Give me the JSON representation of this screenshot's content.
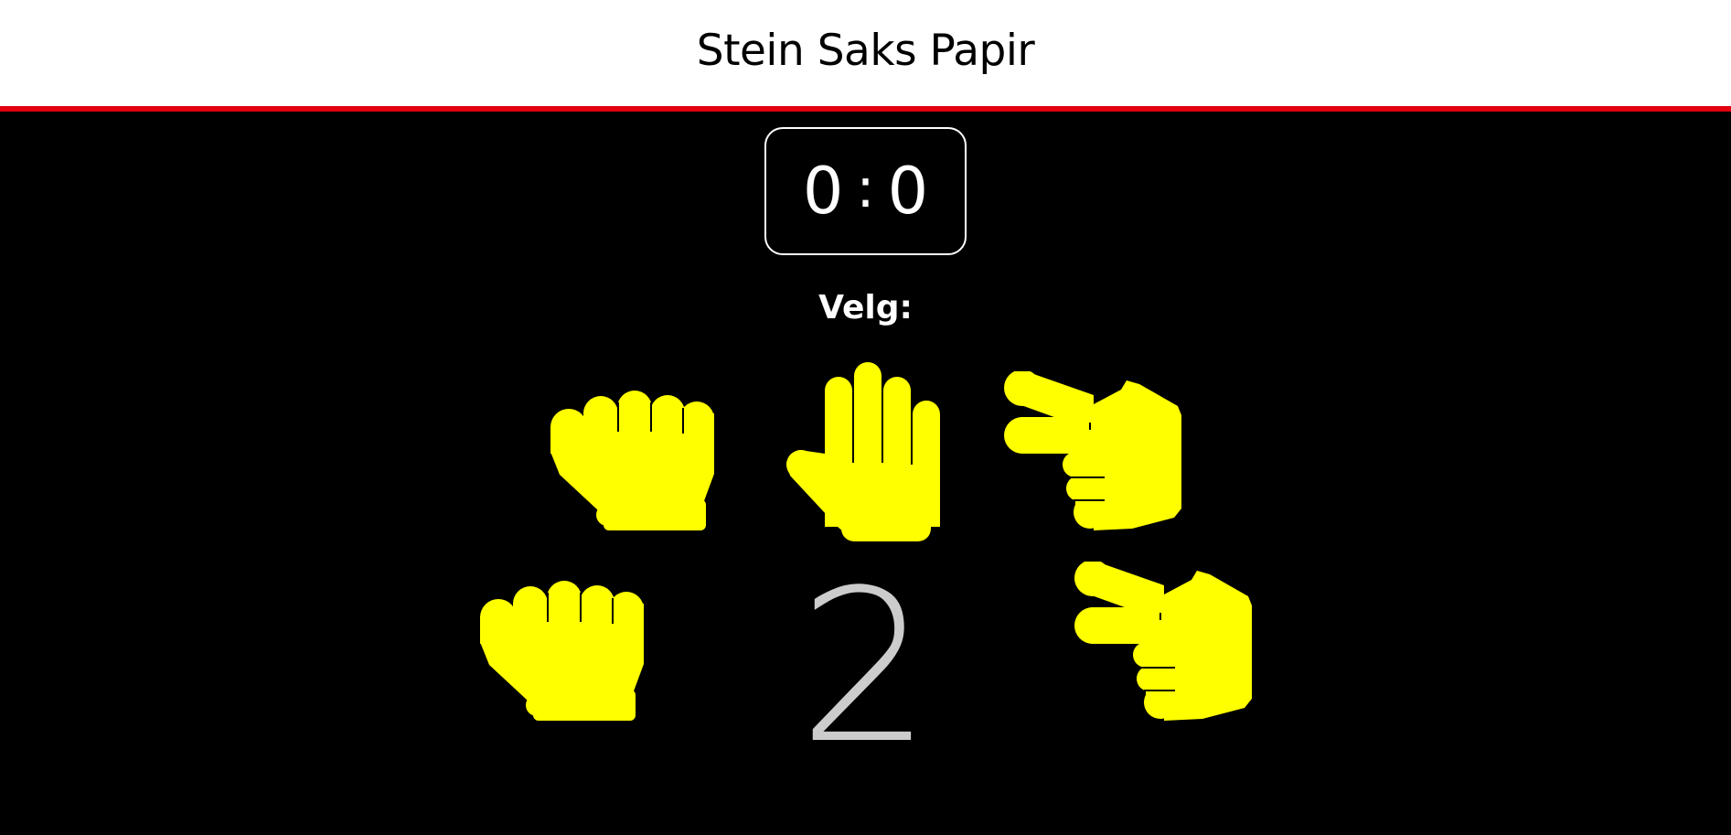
{
  "header": {
    "title": "Stein Saks Papir"
  },
  "score": {
    "player": "0",
    "separator": ":",
    "computer": "0"
  },
  "prompt": "Velg:",
  "choices": [
    {
      "name": "stein",
      "icon": "fist-icon"
    },
    {
      "name": "papir",
      "icon": "open-hand-icon"
    },
    {
      "name": "saks",
      "icon": "scissors-hand-icon"
    }
  ],
  "round": {
    "player_hand_icon": "fist-icon",
    "computer_hand_icon": "scissors-hand-icon",
    "countdown": "2"
  },
  "colors": {
    "header_background": "#ffffff",
    "accent_line": "#e3000f",
    "stage_background": "#000000",
    "hand_fill": "#ffff00",
    "countdown_color": "#cccccc"
  }
}
